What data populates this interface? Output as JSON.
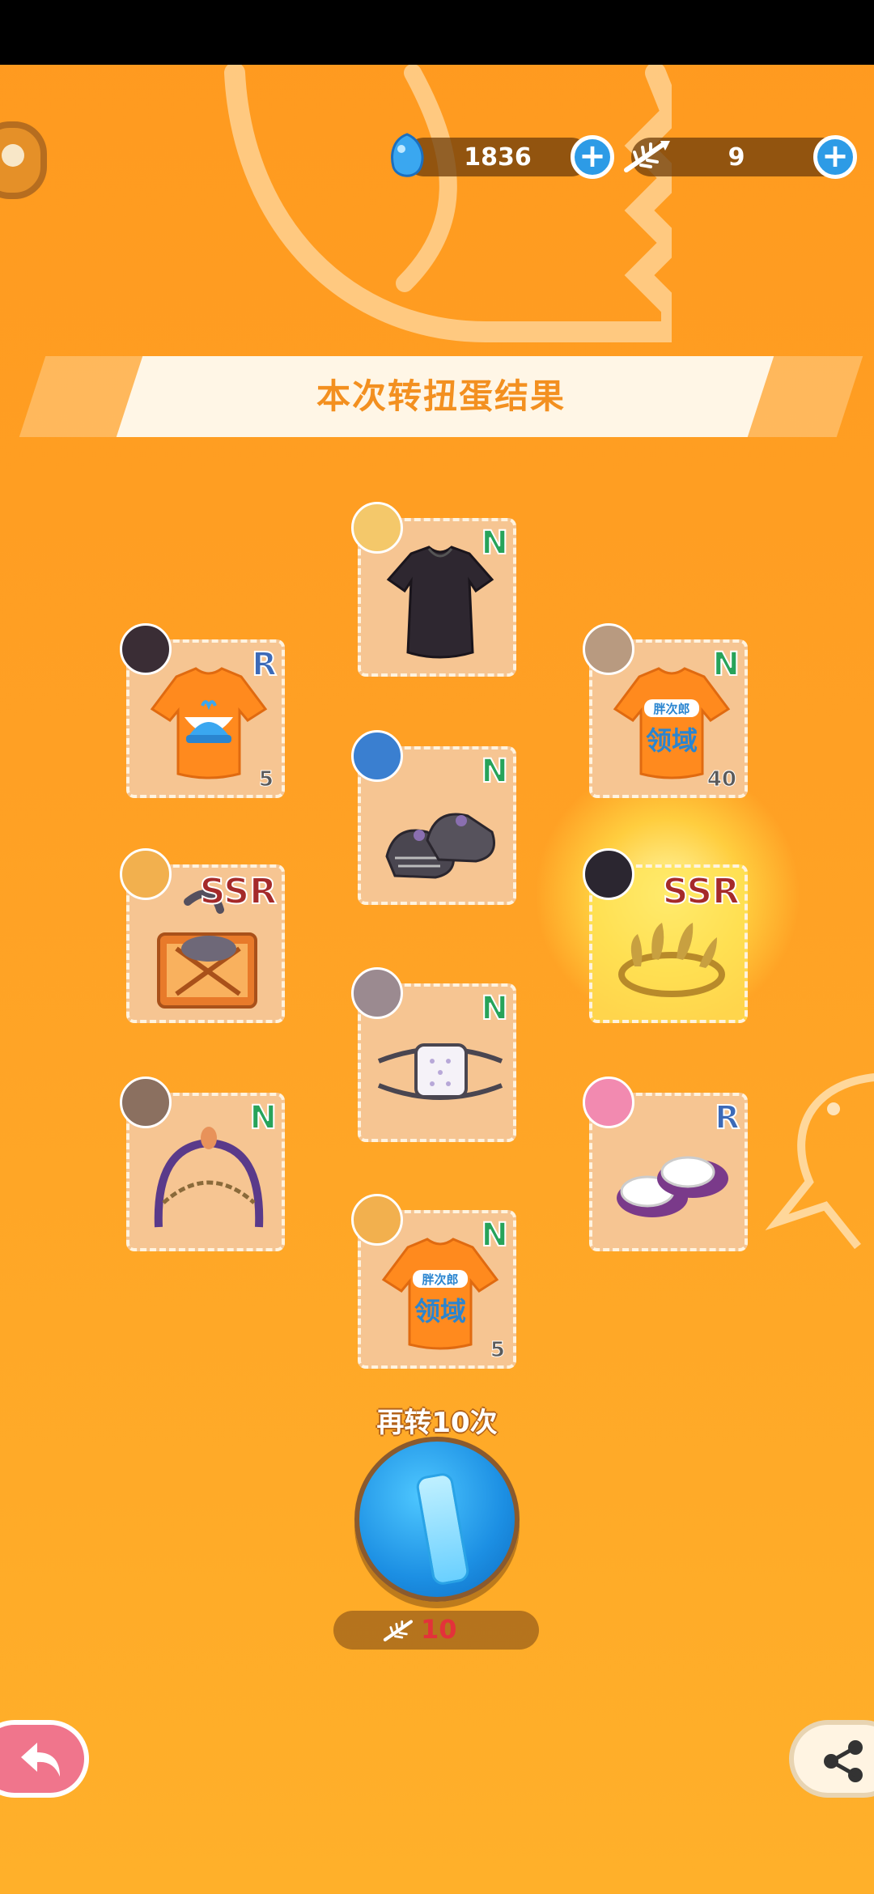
{
  "currencies": {
    "gems": "1836",
    "fish": "9"
  },
  "banner": {
    "title": "本次转扭蛋结果"
  },
  "items": [
    {
      "rarity": "N",
      "count": "",
      "name": "black-dress",
      "avatar_color": "#f4c86a"
    },
    {
      "rarity": "R",
      "count": "5",
      "name": "bell-tshirt",
      "avatar_color": "#3a2d35"
    },
    {
      "rarity": "N",
      "count": "40",
      "name": "logo-tshirt",
      "avatar_color": "#b89a80"
    },
    {
      "rarity": "N",
      "count": "",
      "name": "black-shoes",
      "avatar_color": "#3a7fd0"
    },
    {
      "rarity": "SSR",
      "count": "",
      "name": "cat-box",
      "avatar_color": "#f2b04e"
    },
    {
      "rarity": "SSR",
      "count": "",
      "name": "laurel-crown",
      "avatar_color": "#2b2630"
    },
    {
      "rarity": "N",
      "count": "",
      "name": "eyepatch",
      "avatar_color": "#9b8a90"
    },
    {
      "rarity": "N",
      "count": "",
      "name": "chain-headband",
      "avatar_color": "#8b7060"
    },
    {
      "rarity": "R",
      "count": "",
      "name": "slippers",
      "avatar_color": "#f28ab0"
    },
    {
      "rarity": "N",
      "count": "5",
      "name": "logo-tshirt-2",
      "avatar_color": "#f2b04e"
    }
  ],
  "logo_text": [
    "胖次郎",
    "领域"
  ],
  "spin_again": {
    "label": "再转10次",
    "cost": "10"
  }
}
